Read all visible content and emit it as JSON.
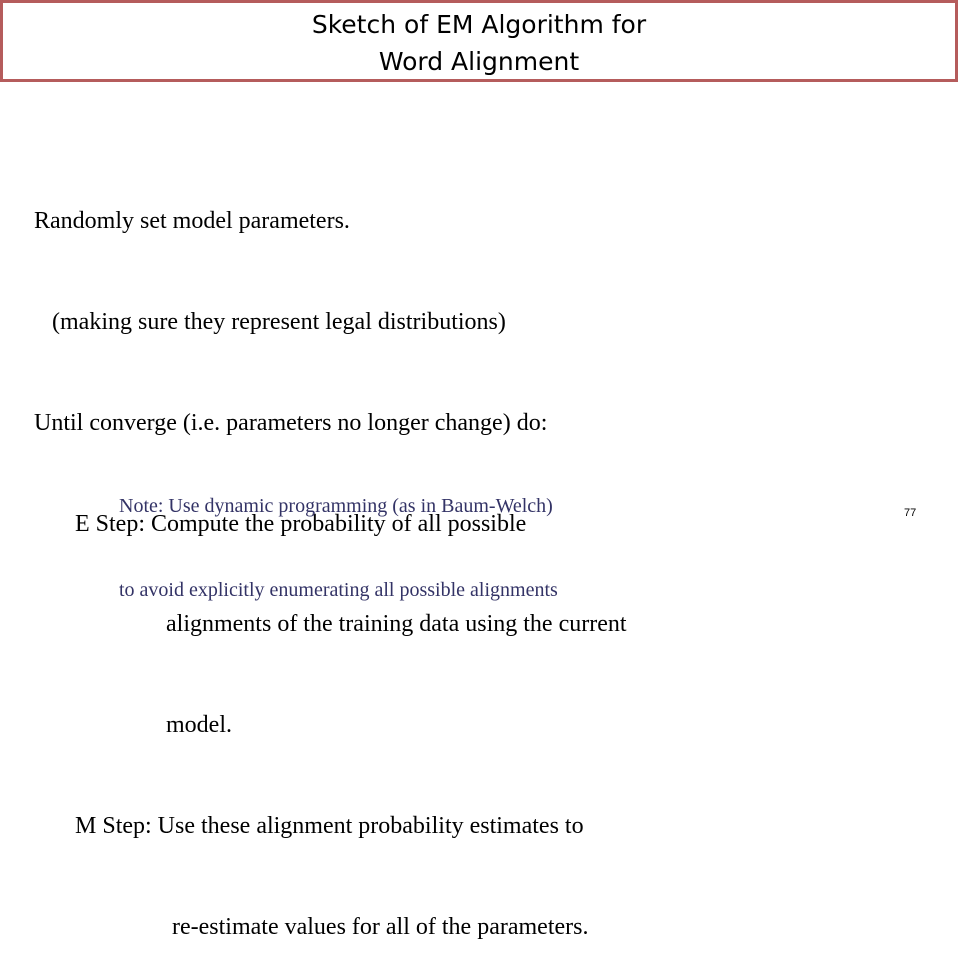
{
  "slide": {
    "title_lines": [
      "Sketch of EM Algorithm for",
      "Word Alignment"
    ],
    "body_lines": [
      "Randomly set model parameters.",
      "(making sure they represent legal distributions)",
      "Until converge (i.e. parameters no longer change) do:",
      "E Step: Compute the probability of all possible",
      "alignments of the training data using the current",
      "model.",
      "M Step: Use these alignment probability estimates to",
      "re-estimate values for all of the parameters."
    ],
    "note_lines": [
      "Note: Use dynamic programming (as in Baum-Welch)",
      "to avoid explicitly enumerating all possible alignments"
    ],
    "page_number": "77"
  },
  "colors": {
    "title_border": "#b55c5c",
    "note_text": "#333366",
    "body_text": "#000000"
  }
}
